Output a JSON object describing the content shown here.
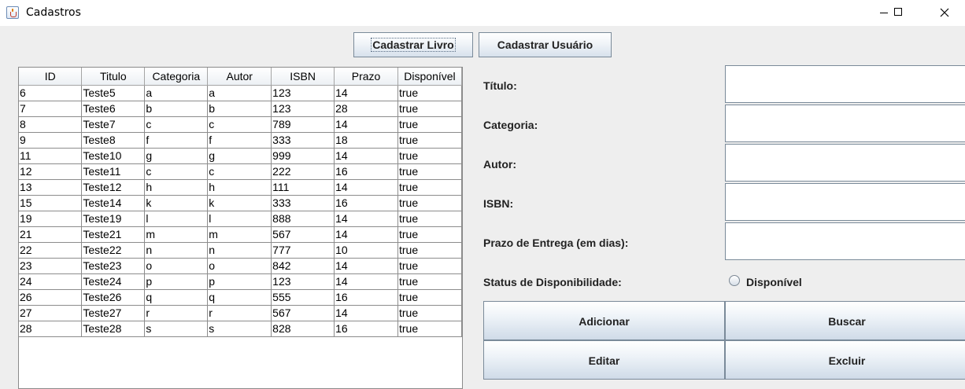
{
  "window": {
    "title": "Cadastros",
    "app_icon": "java-cup-icon",
    "controls": [
      "minimize-icon",
      "maximize-icon",
      "close-icon"
    ]
  },
  "top_buttons": {
    "cadastrar_livro": "Cadastrar Livro",
    "cadastrar_usuario": "Cadastrar Usuário"
  },
  "table": {
    "columns": [
      "ID",
      "Titulo",
      "Categoria",
      "Autor",
      "ISBN",
      "Prazo",
      "Disponível"
    ],
    "rows": [
      [
        "6",
        "Teste5",
        "a",
        "a",
        "123",
        "14",
        "true"
      ],
      [
        "7",
        "Teste6",
        "b",
        "b",
        "123",
        "28",
        "true"
      ],
      [
        "8",
        "Teste7",
        "c",
        "c",
        "789",
        "14",
        "true"
      ],
      [
        "9",
        "Teste8",
        "f",
        "f",
        "333",
        "18",
        "true"
      ],
      [
        "11",
        "Teste10",
        "g",
        "g",
        "999",
        "14",
        "true"
      ],
      [
        "12",
        "Teste11",
        "c",
        "c",
        "222",
        "16",
        "true"
      ],
      [
        "13",
        "Teste12",
        "h",
        "h",
        "111",
        "14",
        "true"
      ],
      [
        "15",
        "Teste14",
        "k",
        "k",
        "333",
        "16",
        "true"
      ],
      [
        "19",
        "Teste19",
        "l",
        "l",
        "888",
        "14",
        "true"
      ],
      [
        "21",
        "Teste21",
        "m",
        "m",
        "567",
        "14",
        "true"
      ],
      [
        "22",
        "Teste22",
        "n",
        "n",
        "777",
        "10",
        "true"
      ],
      [
        "23",
        "Teste23",
        "o",
        "o",
        "842",
        "14",
        "true"
      ],
      [
        "24",
        "Teste24",
        "p",
        "p",
        "123",
        "14",
        "true"
      ],
      [
        "26",
        "Teste26",
        "q",
        "q",
        "555",
        "16",
        "true"
      ],
      [
        "27",
        "Teste27",
        "r",
        "r",
        "567",
        "14",
        "true"
      ],
      [
        "28",
        "Teste28",
        "s",
        "s",
        "828",
        "16",
        "true"
      ]
    ]
  },
  "form": {
    "titulo_label": "Título:",
    "categoria_label": "Categoria:",
    "autor_label": "Autor:",
    "isbn_label": "ISBN:",
    "prazo_label": "Prazo de Entrega (em dias):",
    "titulo_value": "",
    "categoria_value": "",
    "autor_value": "",
    "isbn_value": "",
    "prazo_value": "",
    "status_label": "Status de Disponibilidade:",
    "disponivel_label": "Disponível",
    "disponivel_checked": false
  },
  "actions": {
    "adicionar": "Adicionar",
    "buscar": "Buscar",
    "editar": "Editar",
    "excluir": "Excluir"
  },
  "colors": {
    "window_bg": "#eeeeee",
    "button_gradient_bottom": "#d7e1ec",
    "grid_line": "#8c8c8c"
  }
}
